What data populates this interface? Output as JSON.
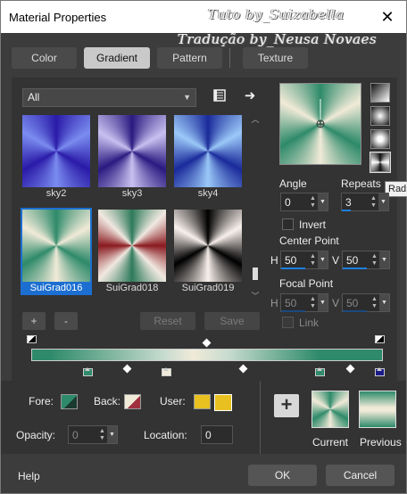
{
  "window": {
    "title": "Material Properties",
    "close_label": "✕"
  },
  "watermark": {
    "line1": "Tuto by_Suizabella",
    "line2": "Tradução by_Neusa Novaes"
  },
  "tabs": [
    {
      "label": "Color",
      "active": false
    },
    {
      "label": "Gradient",
      "active": true
    },
    {
      "label": "Pattern",
      "active": false
    },
    {
      "label": "Texture",
      "active": false
    }
  ],
  "category": {
    "selected": "All"
  },
  "swatches": [
    {
      "name": "sky2",
      "selected": false
    },
    {
      "name": "sky3",
      "selected": false
    },
    {
      "name": "sky4",
      "selected": false
    },
    {
      "name": "SuiGrad016",
      "selected": true
    },
    {
      "name": "SuiGrad018",
      "selected": false
    },
    {
      "name": "SuiGrad019",
      "selected": false
    }
  ],
  "list_buttons": {
    "add": "+",
    "remove": "-",
    "reset": "Reset",
    "save": "Save"
  },
  "angle": {
    "label": "Angle",
    "value": "0"
  },
  "repeats": {
    "label": "Repeats",
    "value": "3"
  },
  "invert": {
    "label": "Invert",
    "checked": false
  },
  "center_point": {
    "label": "Center Point",
    "h_label": "H",
    "h": "50",
    "v_label": "V",
    "v": "50"
  },
  "focal_point": {
    "label": "Focal Point",
    "h_label": "H",
    "h": "50",
    "v_label": "V",
    "v": "50"
  },
  "link": {
    "label": "Link",
    "checked": false
  },
  "tooltip": "Rad",
  "gradient_colors": {
    "green": "#2e8a6a",
    "cream": "#f0ead8",
    "navy": "#1a1a8a"
  },
  "bottom": {
    "fore_label": "Fore:",
    "back_label": "Back:",
    "user_label": "User:",
    "opacity_label": "Opacity:",
    "opacity_value": "0",
    "location_label": "Location:",
    "location_value": "0",
    "current_label": "Current",
    "previous_label": "Previous",
    "add_label": "+"
  },
  "footer": {
    "help": "Help",
    "ok": "OK",
    "cancel": "Cancel"
  },
  "icons": {
    "library": "library-icon",
    "arrow": "arrow-right-icon"
  }
}
